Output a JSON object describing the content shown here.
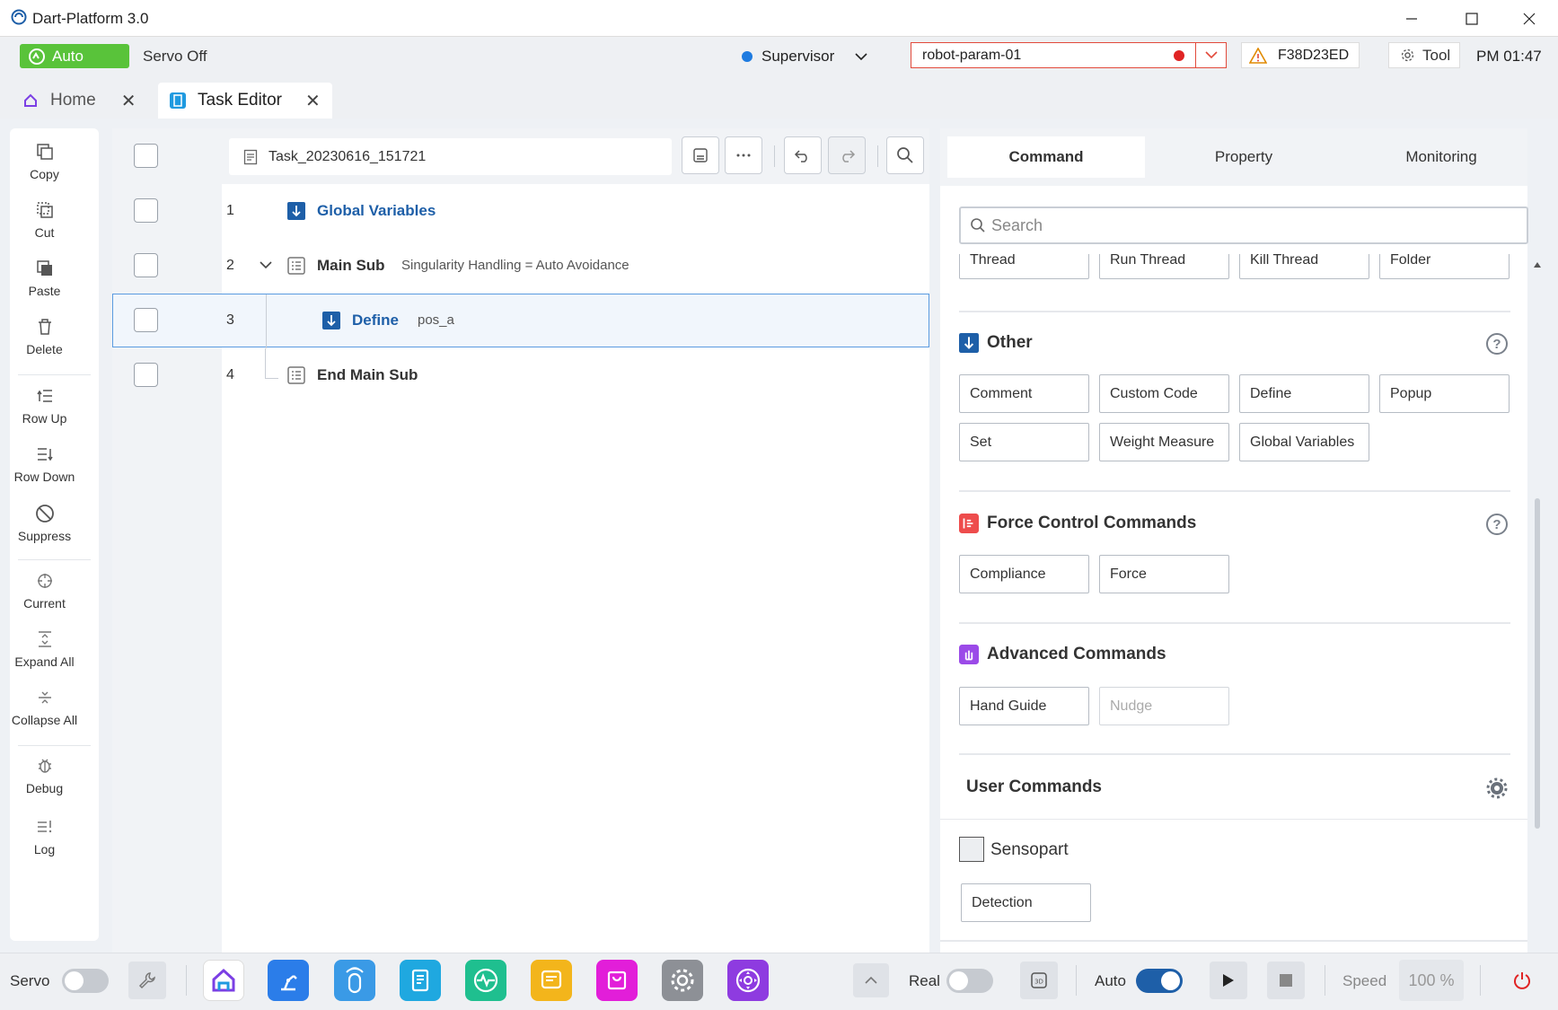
{
  "window": {
    "title": "Dart-Platform 3.0"
  },
  "status": {
    "mode": "Auto",
    "servo": "Servo Off",
    "user": "Supervisor",
    "robot_param": "robot-param-01",
    "serial": "F38D23ED",
    "tool": "Tool",
    "time": "PM 01:47"
  },
  "tabs": [
    {
      "label": "Home",
      "active": false
    },
    {
      "label": "Task Editor",
      "active": true
    }
  ],
  "left_toolbar": [
    {
      "label": "Copy",
      "icon": "copy-icon"
    },
    {
      "label": "Cut",
      "icon": "cut-icon"
    },
    {
      "label": "Paste",
      "icon": "paste-icon"
    },
    {
      "label": "Delete",
      "icon": "trash-icon"
    },
    {
      "label": "Row Up",
      "icon": "row-up-icon"
    },
    {
      "label": "Row Down",
      "icon": "row-down-icon"
    },
    {
      "label": "Suppress",
      "icon": "suppress-icon"
    },
    {
      "label": "Current",
      "icon": "crosshair-icon"
    },
    {
      "label": "Expand All",
      "icon": "expand-icon"
    },
    {
      "label": "Collapse All",
      "icon": "collapse-icon"
    },
    {
      "label": "Debug",
      "icon": "bug-icon"
    },
    {
      "label": "Log",
      "icon": "log-icon"
    }
  ],
  "task": {
    "file": "Task_20230616_151721",
    "rows": [
      {
        "num": "1",
        "title": "Global Variables",
        "desc": ""
      },
      {
        "num": "2",
        "title": "Main Sub",
        "desc": "Singularity Handling = Auto Avoidance"
      },
      {
        "num": "3",
        "title": "Define",
        "desc": "pos_a"
      },
      {
        "num": "4",
        "title": "End Main Sub",
        "desc": ""
      }
    ]
  },
  "right_panel": {
    "tabs": [
      "Command",
      "Property",
      "Monitoring"
    ],
    "active_tab": "Command",
    "search_placeholder": "Search",
    "top_partial": [
      "Thread",
      "Run Thread",
      "Kill Thread",
      "Folder"
    ],
    "sections": {
      "other": {
        "title": "Other",
        "buttons": [
          "Comment",
          "Custom Code",
          "Define",
          "Popup",
          "Set",
          "Weight Measure",
          "Global Variables"
        ]
      },
      "force": {
        "title": "Force Control Commands",
        "buttons": [
          "Compliance",
          "Force"
        ]
      },
      "advanced": {
        "title": "Advanced Commands",
        "buttons": [
          "Hand Guide",
          "Nudge"
        ]
      },
      "user": {
        "title": "User Commands"
      }
    },
    "user_group": {
      "name": "Sensopart",
      "buttons": [
        "Detection"
      ]
    }
  },
  "bottom": {
    "servo_label": "Servo",
    "real_label": "Real",
    "auto_label": "Auto",
    "speed_label": "Speed",
    "speed_value": "100 %",
    "servo_on": false,
    "real_on": false,
    "auto_on": true
  },
  "colors": {
    "accent": "#1e5fa8",
    "auto_green": "#59c33a",
    "alert_red": "#e24a3b"
  }
}
